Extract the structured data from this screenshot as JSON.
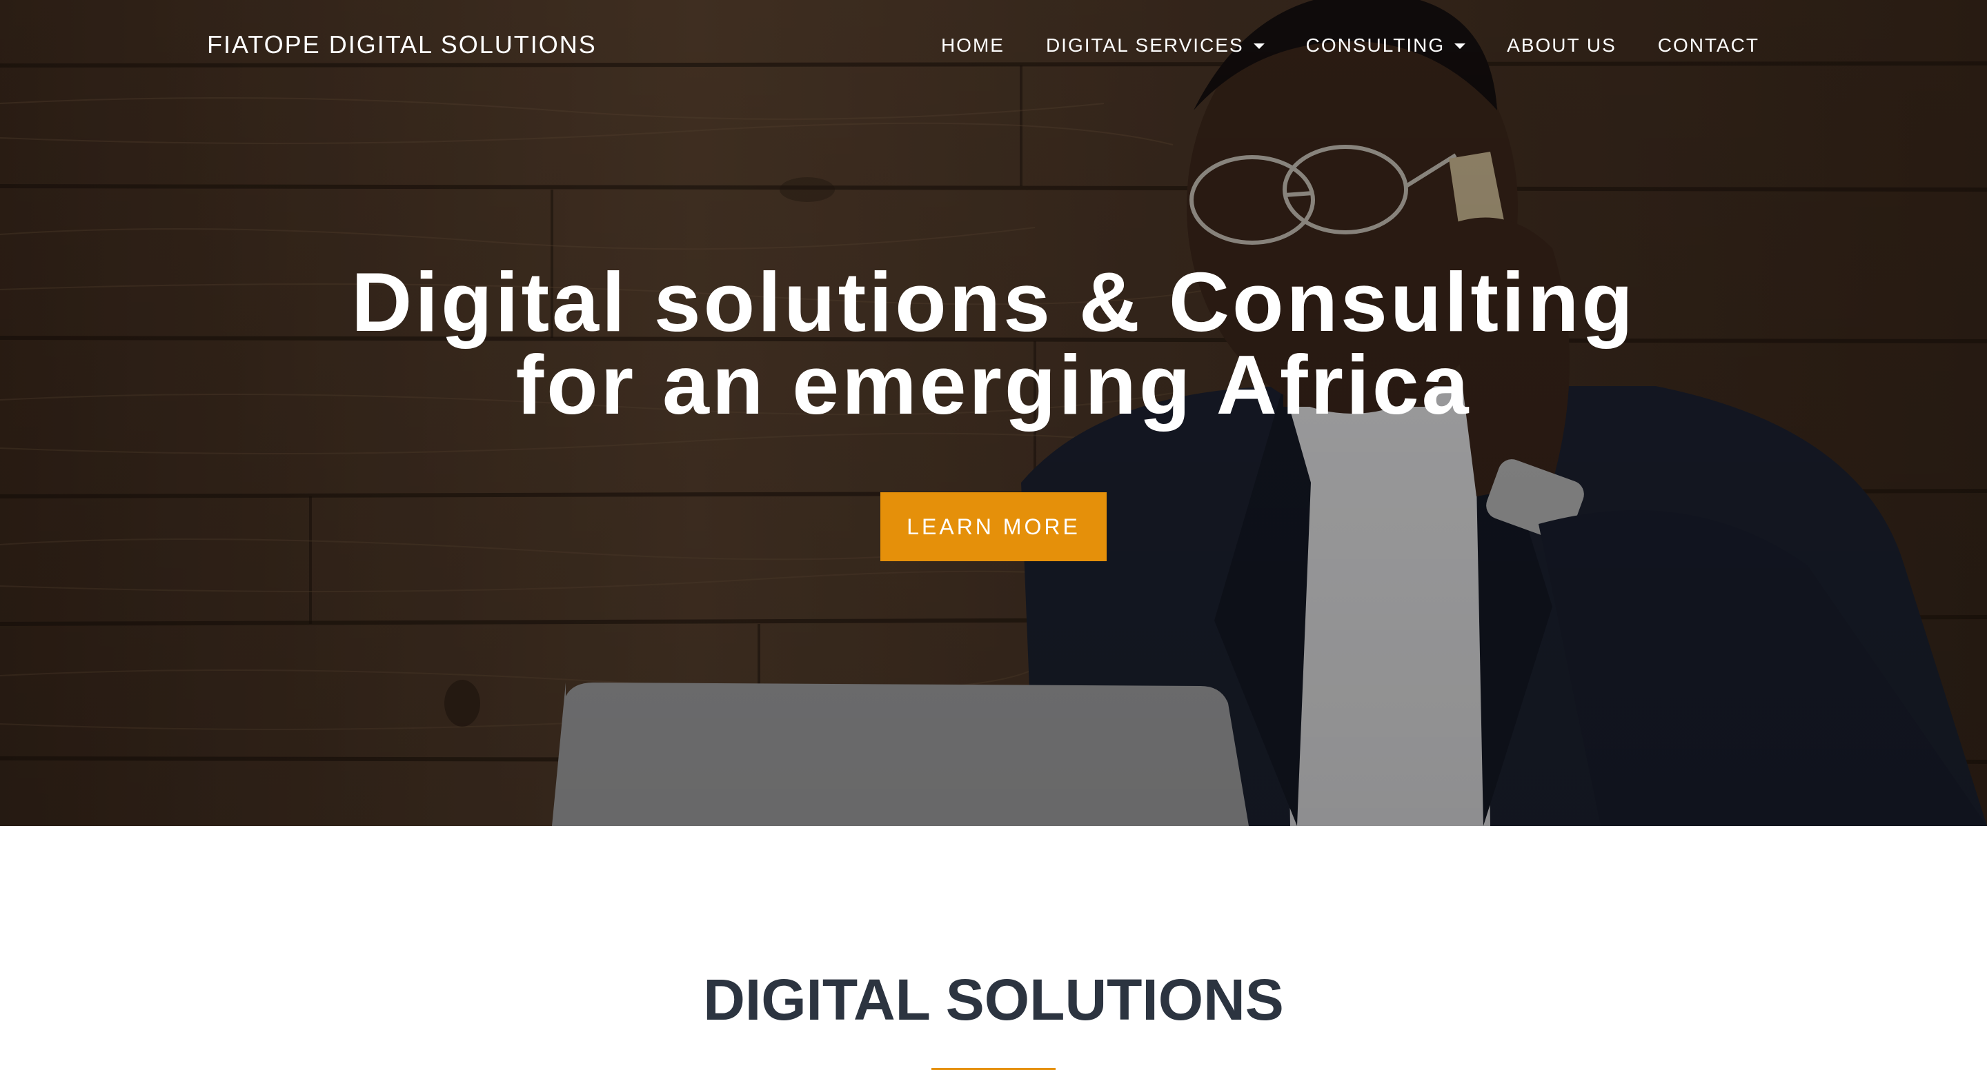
{
  "brand": {
    "name": "FIATOPE DIGITAL SOLUTIONS"
  },
  "nav": {
    "items": [
      {
        "label": "HOME",
        "dropdown": false
      },
      {
        "label": "DIGITAL SERVICES",
        "dropdown": true
      },
      {
        "label": "CONSULTING",
        "dropdown": true
      },
      {
        "label": "ABOUT US",
        "dropdown": false
      },
      {
        "label": "CONTACT",
        "dropdown": false
      }
    ]
  },
  "hero": {
    "title_line1": "Digital solutions & Consulting",
    "title_line2": "for an emerging Africa",
    "cta_label": "LEARN MORE",
    "background_description_icon": "photo-man-on-phone-with-laptop"
  },
  "section": {
    "title": "DIGITAL SOLUTIONS"
  },
  "colors": {
    "accent": "#e5900a",
    "heading": "#2c3440",
    "nav_text": "#ffffff"
  }
}
